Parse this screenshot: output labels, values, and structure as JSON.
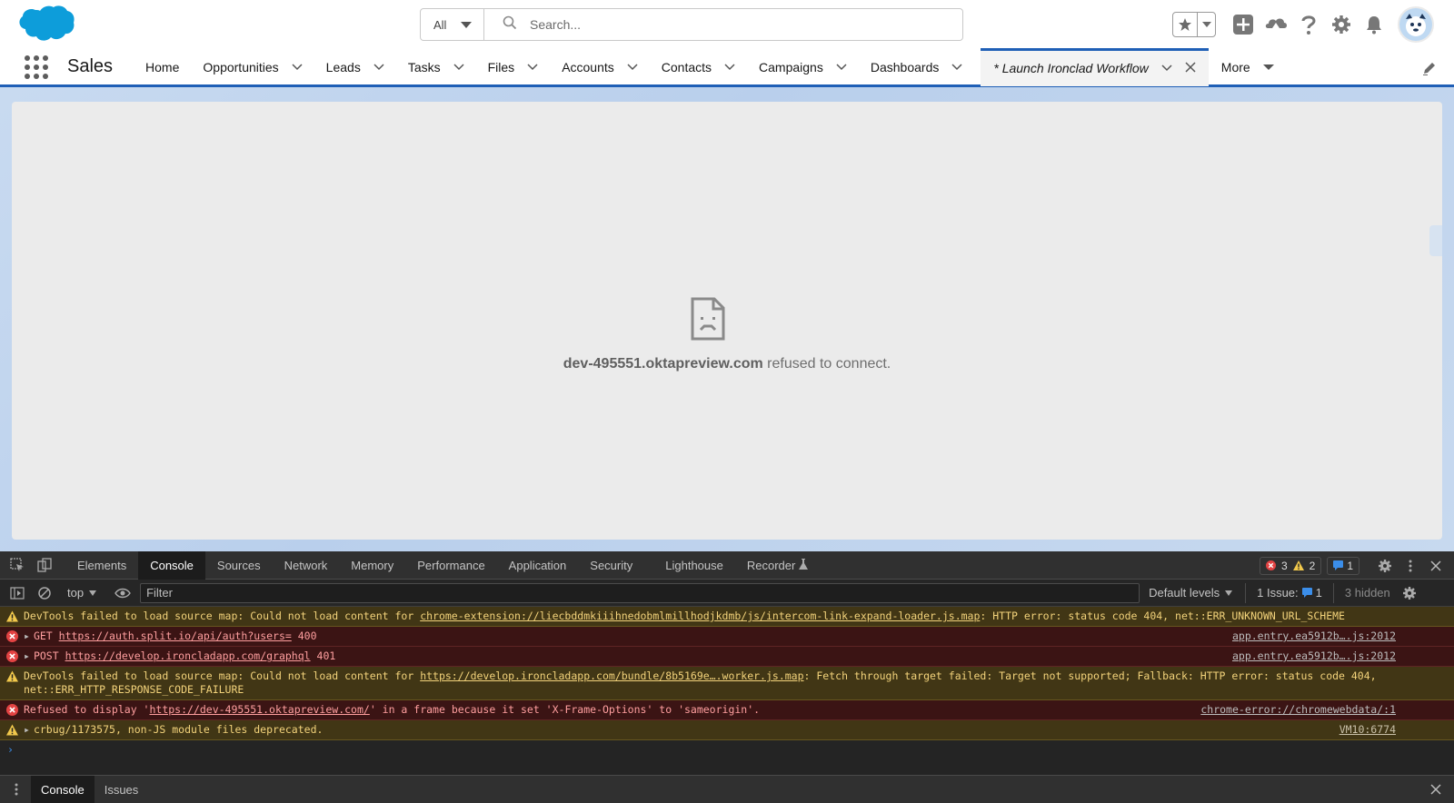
{
  "global_header": {
    "search_scope": "All",
    "search_placeholder": "Search...",
    "icons": [
      "favorites-star-icon",
      "favorites-list-icon",
      "global-actions-icon",
      "trailhead-icon",
      "help-icon",
      "setup-gear-icon",
      "notifications-bell-icon",
      "user-avatar"
    ]
  },
  "nav": {
    "app_name": "Sales",
    "items": [
      {
        "label": "Home",
        "has_menu": false
      },
      {
        "label": "Opportunities",
        "has_menu": true
      },
      {
        "label": "Leads",
        "has_menu": true
      },
      {
        "label": "Tasks",
        "has_menu": true
      },
      {
        "label": "Files",
        "has_menu": true
      },
      {
        "label": "Accounts",
        "has_menu": true
      },
      {
        "label": "Contacts",
        "has_menu": true
      },
      {
        "label": "Campaigns",
        "has_menu": true
      },
      {
        "label": "Dashboards",
        "has_menu": true
      }
    ],
    "active_tab": "* Launch Ironclad Workflow",
    "more_label": "More"
  },
  "frame": {
    "host": "dev-495551.oktapreview.com",
    "message": " refused to connect."
  },
  "devtools": {
    "tabs": [
      "Elements",
      "Console",
      "Sources",
      "Network",
      "Memory",
      "Performance",
      "Application",
      "Security",
      "Lighthouse",
      "Recorder"
    ],
    "active_tab": "Console",
    "error_count": "3",
    "warning_count": "2",
    "info_count": "1",
    "context": "top",
    "filter_placeholder": "Filter",
    "levels_label": "Default levels",
    "issues_label": "1 Issue:",
    "issues_count": "1",
    "hidden_label": "3 hidden",
    "messages": [
      {
        "level": "warn",
        "prefix": "DevTools failed to load source map: Could not load content for ",
        "link": "chrome-extension://liecbddmkiiihnedobmlmillhodjkdmb/js/intercom-link-expand-loader.js.map",
        "suffix": ": HTTP error: status code 404, net::ERR_UNKNOWN_URL_SCHEME",
        "source": ""
      },
      {
        "level": "err",
        "prefix": "GET ",
        "link": "https://auth.split.io/api/auth?users=",
        "suffix": " 400",
        "source": "app.entry.ea5912b….js:2012",
        "expandable": true
      },
      {
        "level": "err",
        "prefix": "POST ",
        "link": "https://develop.ironcladapp.com/graphql",
        "suffix": " 401",
        "source": "app.entry.ea5912b….js:2012",
        "expandable": true
      },
      {
        "level": "warn",
        "prefix": "DevTools failed to load source map: Could not load content for ",
        "link": "https://develop.ironcladapp.com/bundle/8b5169e….worker.js.map",
        "suffix": ": Fetch through target failed: Target not supported; Fallback: HTTP error: status code 404, net::ERR_HTTP_RESPONSE_CODE_FAILURE",
        "source": ""
      },
      {
        "level": "err",
        "prefix": "Refused to display '",
        "link": "https://dev-495551.oktapreview.com/",
        "suffix": "' in a frame because it set 'X-Frame-Options' to 'sameorigin'.",
        "source": "chrome-error://chromewebdata/:1"
      },
      {
        "level": "warn",
        "prefix": "crbug/1173575, non-JS module files deprecated.",
        "link": "",
        "suffix": "",
        "source": "VM10:6774",
        "expandable": true
      }
    ],
    "drawer_tabs": [
      "Console",
      "Issues"
    ],
    "drawer_active": "Console"
  }
}
